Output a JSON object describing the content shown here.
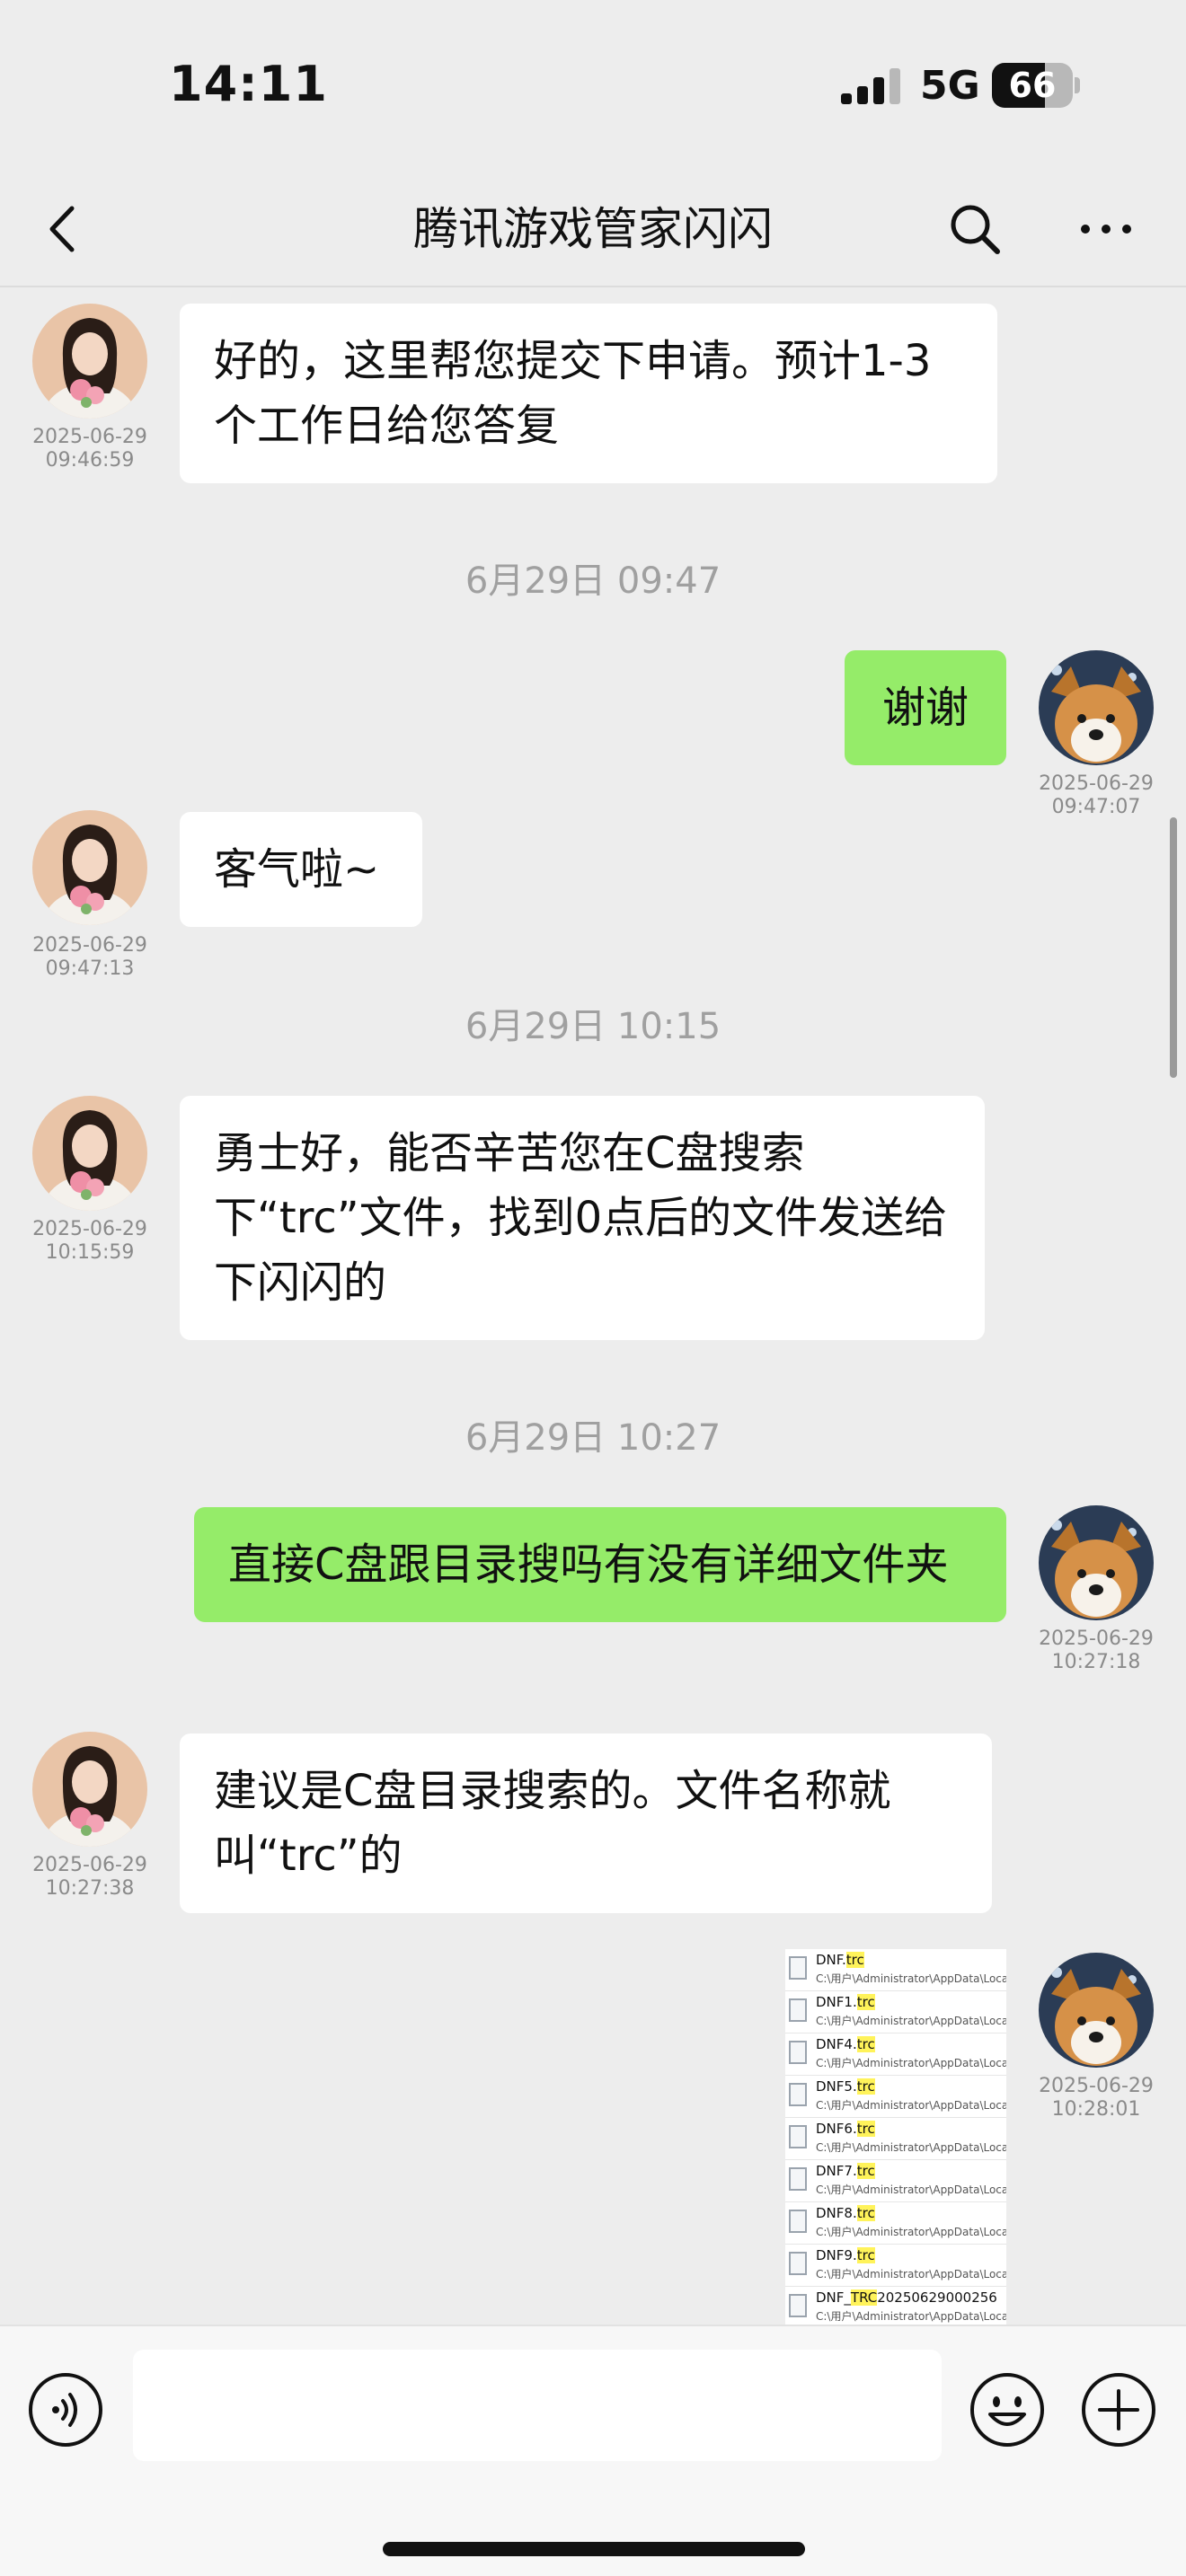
{
  "status": {
    "time": "14:11",
    "network": "5G",
    "battery": "66",
    "battery_level": 0.66
  },
  "header": {
    "title": "腾讯游戏管家闪闪"
  },
  "colors": {
    "incoming_bubble": "#ffffff",
    "outgoing_bubble": "#95ec69",
    "background": "#ededed"
  },
  "messages": [
    {
      "side": "in",
      "text": "好的，这里帮您提交下申请。预计1-3个工作日给您答复",
      "date": "2025-06-29",
      "time": "09:46:59"
    },
    {
      "side": "out",
      "text": "谢谢",
      "date": "2025-06-29",
      "time": "09:47:07"
    },
    {
      "side": "in",
      "text": "客气啦~",
      "date": "2025-06-29",
      "time": "09:47:13"
    },
    {
      "side": "in",
      "text": "勇士好，能否辛苦您在C盘搜索下“trc”文件，找到0点后的文件发送给下闪闪的",
      "date": "2025-06-29",
      "time": "10:15:59"
    },
    {
      "side": "out",
      "text": "直接C盘跟目录搜吗有没有详细文件夹",
      "date": "2025-06-29",
      "time": "10:27:18"
    },
    {
      "side": "in",
      "text": "建议是C盘目录搜索的。文件名称就叫“trc”的",
      "date": "2025-06-29",
      "time": "10:27:38"
    },
    {
      "side": "out",
      "type": "image",
      "date": "2025-06-29",
      "time": "10:28:01"
    }
  ],
  "timestamps": [
    "6月29日 09:47",
    "6月29日 10:15",
    "6月29日 10:27"
  ],
  "file_list": {
    "path": "C:\\用户\\Administrator\\AppData\\LocalL",
    "items": [
      {
        "base": "DNF.",
        "ext": "trc",
        "suffix": ""
      },
      {
        "base": "DNF1.",
        "ext": "trc",
        "suffix": ""
      },
      {
        "base": "DNF4.",
        "ext": "trc",
        "suffix": ""
      },
      {
        "base": "DNF5.",
        "ext": "trc",
        "suffix": ""
      },
      {
        "base": "DNF6.",
        "ext": "trc",
        "suffix": ""
      },
      {
        "base": "DNF7.",
        "ext": "trc",
        "suffix": ""
      },
      {
        "base": "DNF8.",
        "ext": "trc",
        "suffix": ""
      },
      {
        "base": "DNF9.",
        "ext": "trc",
        "suffix": ""
      },
      {
        "base": "DNF_",
        "ext": "TRC",
        "suffix": "20250629000256"
      }
    ]
  },
  "icons": {
    "back": "chevron-left-icon",
    "search": "search-icon",
    "more": "more-icon",
    "voice": "voice-icon",
    "emoji": "emoji-icon",
    "plus": "plus-icon"
  }
}
